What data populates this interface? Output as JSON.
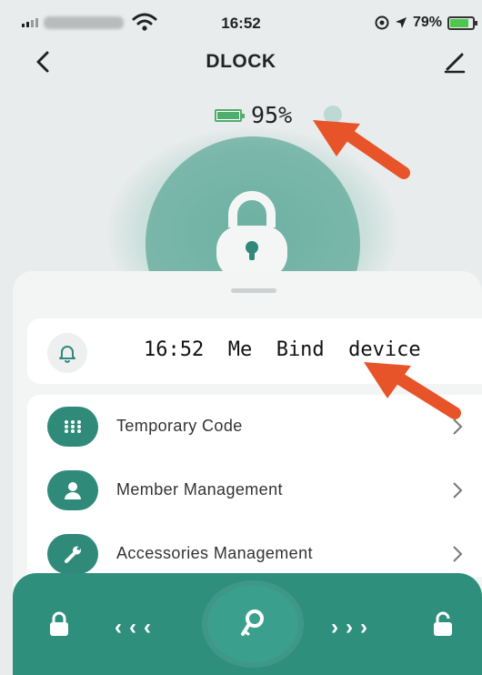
{
  "status_bar": {
    "time": "16:52",
    "battery_percent": "79%"
  },
  "nav": {
    "title": "DLOCK"
  },
  "lock_battery": {
    "percent": "95%",
    "level": 0.95
  },
  "notification": {
    "message": "16:52  Me  Bind  device"
  },
  "menu": {
    "items": [
      {
        "label": "Temporary Code",
        "icon": "keypad-icon"
      },
      {
        "label": "Member Management",
        "icon": "person-icon"
      },
      {
        "label": "Accessories Management",
        "icon": "wrench-icon"
      }
    ]
  },
  "bottom_bar": {
    "left_chevrons": "‹‹‹",
    "right_chevrons": "›››"
  },
  "colors": {
    "accent": "#2f8f7d",
    "accent_dark": "#2f8a7a",
    "arrow": "#e8542a",
    "battery_green": "#4fae6d"
  }
}
